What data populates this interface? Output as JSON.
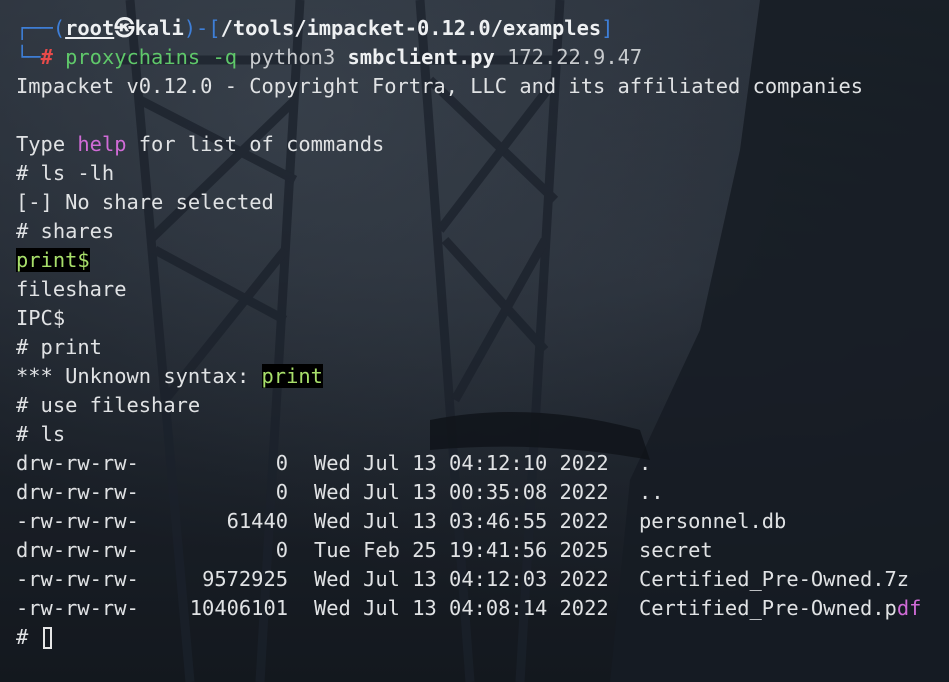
{
  "prompt": {
    "open_paren": "┌──(",
    "user": "root",
    "at_symbol": "㉿",
    "host": "kali",
    "close_paren": ")-[",
    "path": "/tools/impacket-0.12.0/examples",
    "close_bracket": "]",
    "line2_corner": "└─",
    "hash": "#",
    "command_prog": "proxychains",
    "command_flag": "-q",
    "command_python": "python3",
    "command_script": "smbclient.py",
    "command_ip": "172.22.9.47"
  },
  "output": {
    "banner": "Impacket v0.12.0 - Copyright Fortra, LLC and its affiliated companies",
    "type_prefix": "Type ",
    "type_help": "help",
    "type_suffix": " for list of commands",
    "cmd_ls_lh": "# ls -lh",
    "no_share": "[-] No share selected",
    "cmd_shares": "# shares",
    "share_print": "print$",
    "share_fileshare": "fileshare",
    "share_ipc": "IPC$",
    "cmd_print": "# print",
    "unknown_prefix": "*** Unknown syntax: ",
    "unknown_word": "print",
    "cmd_use": "# use fileshare",
    "cmd_ls": "# ls",
    "final_prompt": "# "
  },
  "listing": [
    {
      "perm": "drw-rw-rw-",
      "size": "0",
      "date": "Wed Jul 13 04:12:10 2022",
      "name": ".",
      "tail": ""
    },
    {
      "perm": "drw-rw-rw-",
      "size": "0",
      "date": "Wed Jul 13 00:35:08 2022",
      "name": "..",
      "tail": ""
    },
    {
      "perm": "-rw-rw-rw-",
      "size": "61440",
      "date": "Wed Jul 13 03:46:55 2022",
      "name": "personnel.db",
      "tail": ""
    },
    {
      "perm": "drw-rw-rw-",
      "size": "0",
      "date": "Tue Feb 25 19:41:56 2025",
      "name": "secret",
      "tail": ""
    },
    {
      "perm": "-rw-rw-rw-",
      "size": "9572925",
      "date": "Wed Jul 13 04:12:03 2022",
      "name": "Certified_Pre-Owned.7z",
      "tail": ""
    },
    {
      "perm": "-rw-rw-rw-",
      "size": "10406101",
      "date": "Wed Jul 13 04:08:14 2022",
      "name": "Certified_Pre-Owned.p",
      "tail": "df"
    }
  ],
  "colors": {
    "prompt_blue": "#3e7fd8",
    "hash_red": "#e74a4a",
    "command_green": "#5fc86a",
    "help_magenta": "#d06bd6",
    "highlight_green": "#a8df6a"
  }
}
